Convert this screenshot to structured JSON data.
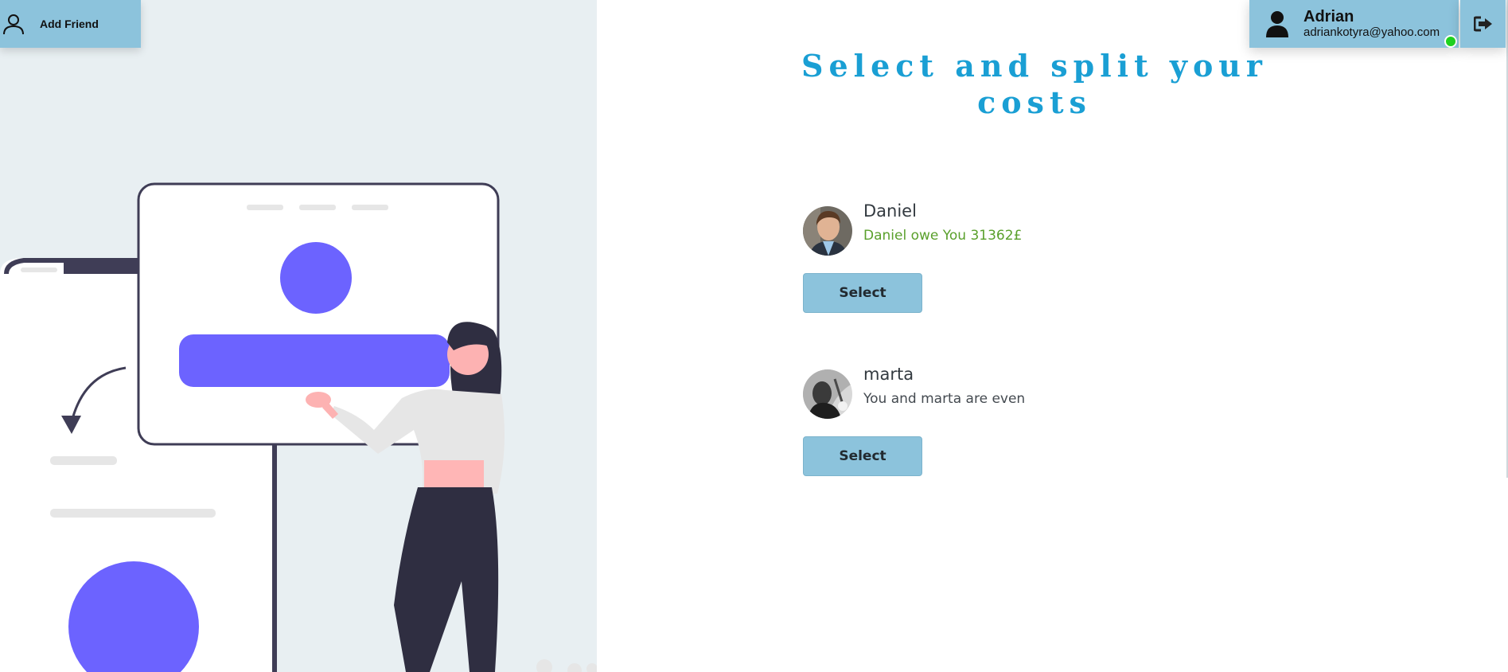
{
  "header": {
    "add_friend_label": "Add Friend",
    "user": {
      "name": "Adrian",
      "email": "adriankotyra@yahoo.com",
      "online": true
    }
  },
  "main": {
    "title": "Select and split your costs",
    "friends": [
      {
        "name": "Daniel",
        "status": "Daniel owe You 31362£",
        "status_type": "owed",
        "select_label": "Select"
      },
      {
        "name": "marta",
        "status": "You and marta are even",
        "status_type": "even",
        "select_label": "Select"
      }
    ]
  },
  "illustration": {
    "currency_symbol": "$"
  },
  "colors": {
    "accent": "#8cc3dc",
    "title": "#1a9fd4",
    "owed": "#5aa02c",
    "online": "#1fd31f",
    "illustration_purple": "#6c63ff"
  }
}
